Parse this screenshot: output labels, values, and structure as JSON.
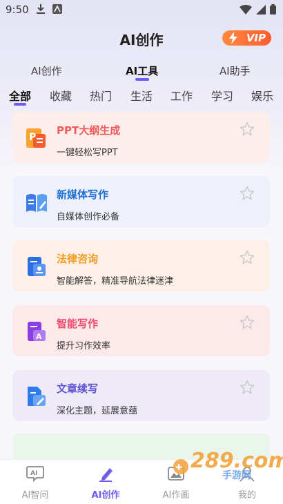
{
  "status": {
    "time": "9:50"
  },
  "header": {
    "title": "AI创作",
    "vip_label": "VIP"
  },
  "tabs": [
    {
      "label": "AI创作"
    },
    {
      "label": "AI工具"
    },
    {
      "label": "AI助手"
    }
  ],
  "categories": [
    "全部",
    "收藏",
    "热门",
    "生活",
    "工作",
    "学习",
    "娱乐"
  ],
  "tools": [
    {
      "name": "PPT大纲生成",
      "desc": "一键轻松写PPT",
      "color": "#f05a5a",
      "bg": "#fdeeec",
      "icon": "ppt-icon"
    },
    {
      "name": "新媒体写作",
      "desc": "自媒体创作必备",
      "color": "#1f6fd6",
      "bg": "#eef0fb",
      "icon": "book-icon"
    },
    {
      "name": "法律咨询",
      "desc": "智能解答，精准导航法律迷津",
      "color": "#f39a1f",
      "bg": "#fdf0e8",
      "icon": "law-icon"
    },
    {
      "name": "智能写作",
      "desc": "提升习作效率",
      "color": "#ef4b6e",
      "bg": "#fde8ea",
      "icon": "write-icon"
    },
    {
      "name": "文章续写",
      "desc": "深化主题，延展意蕴",
      "color": "#5b4fd6",
      "bg": "#efeaf8",
      "icon": "doc-icon"
    }
  ],
  "bottom_nav": [
    {
      "label": "AI智问",
      "icon": "ai-chat-icon"
    },
    {
      "label": "AI创作",
      "icon": "pen-icon"
    },
    {
      "label": "AI作画",
      "icon": "paint-icon"
    },
    {
      "label": "我的",
      "icon": "profile-icon"
    }
  ],
  "watermark": {
    "text": "289.com",
    "sub": "手游网"
  }
}
